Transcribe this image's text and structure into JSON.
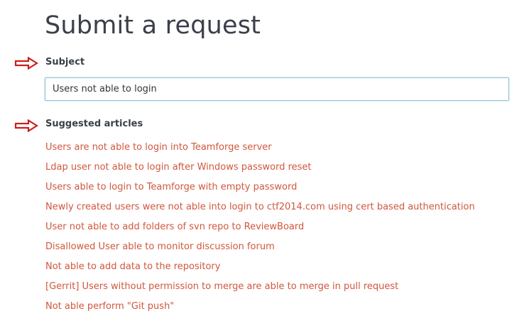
{
  "page": {
    "title": "Submit a request"
  },
  "form": {
    "subject": {
      "label": "Subject",
      "value": "Users not able to login"
    },
    "suggested_articles": {
      "label": "Suggested articles",
      "items": [
        "Users are not able to login into Teamforge server",
        "Ldap user not able to login after Windows password reset",
        "Users able to login to Teamforge with empty password",
        "Newly created users were not able into login to ctf2014.com using cert based authentication",
        "User not able to add folders of svn repo to ReviewBoard",
        "Disallowed User able to monitor discussion forum",
        "Not able to add data to the repository",
        "[Gerrit] Users without permission to merge are able to merge in pull request",
        "Not able perform \"Git push\""
      ]
    }
  },
  "annotations": {
    "arrow_color": "#cc1f1f",
    "arrow_icon": "arrow-right-outline-icon"
  },
  "theme": {
    "link_color": "#d0573c",
    "heading_color": "#3a3f4a",
    "input_border": "#8fc1d8"
  }
}
